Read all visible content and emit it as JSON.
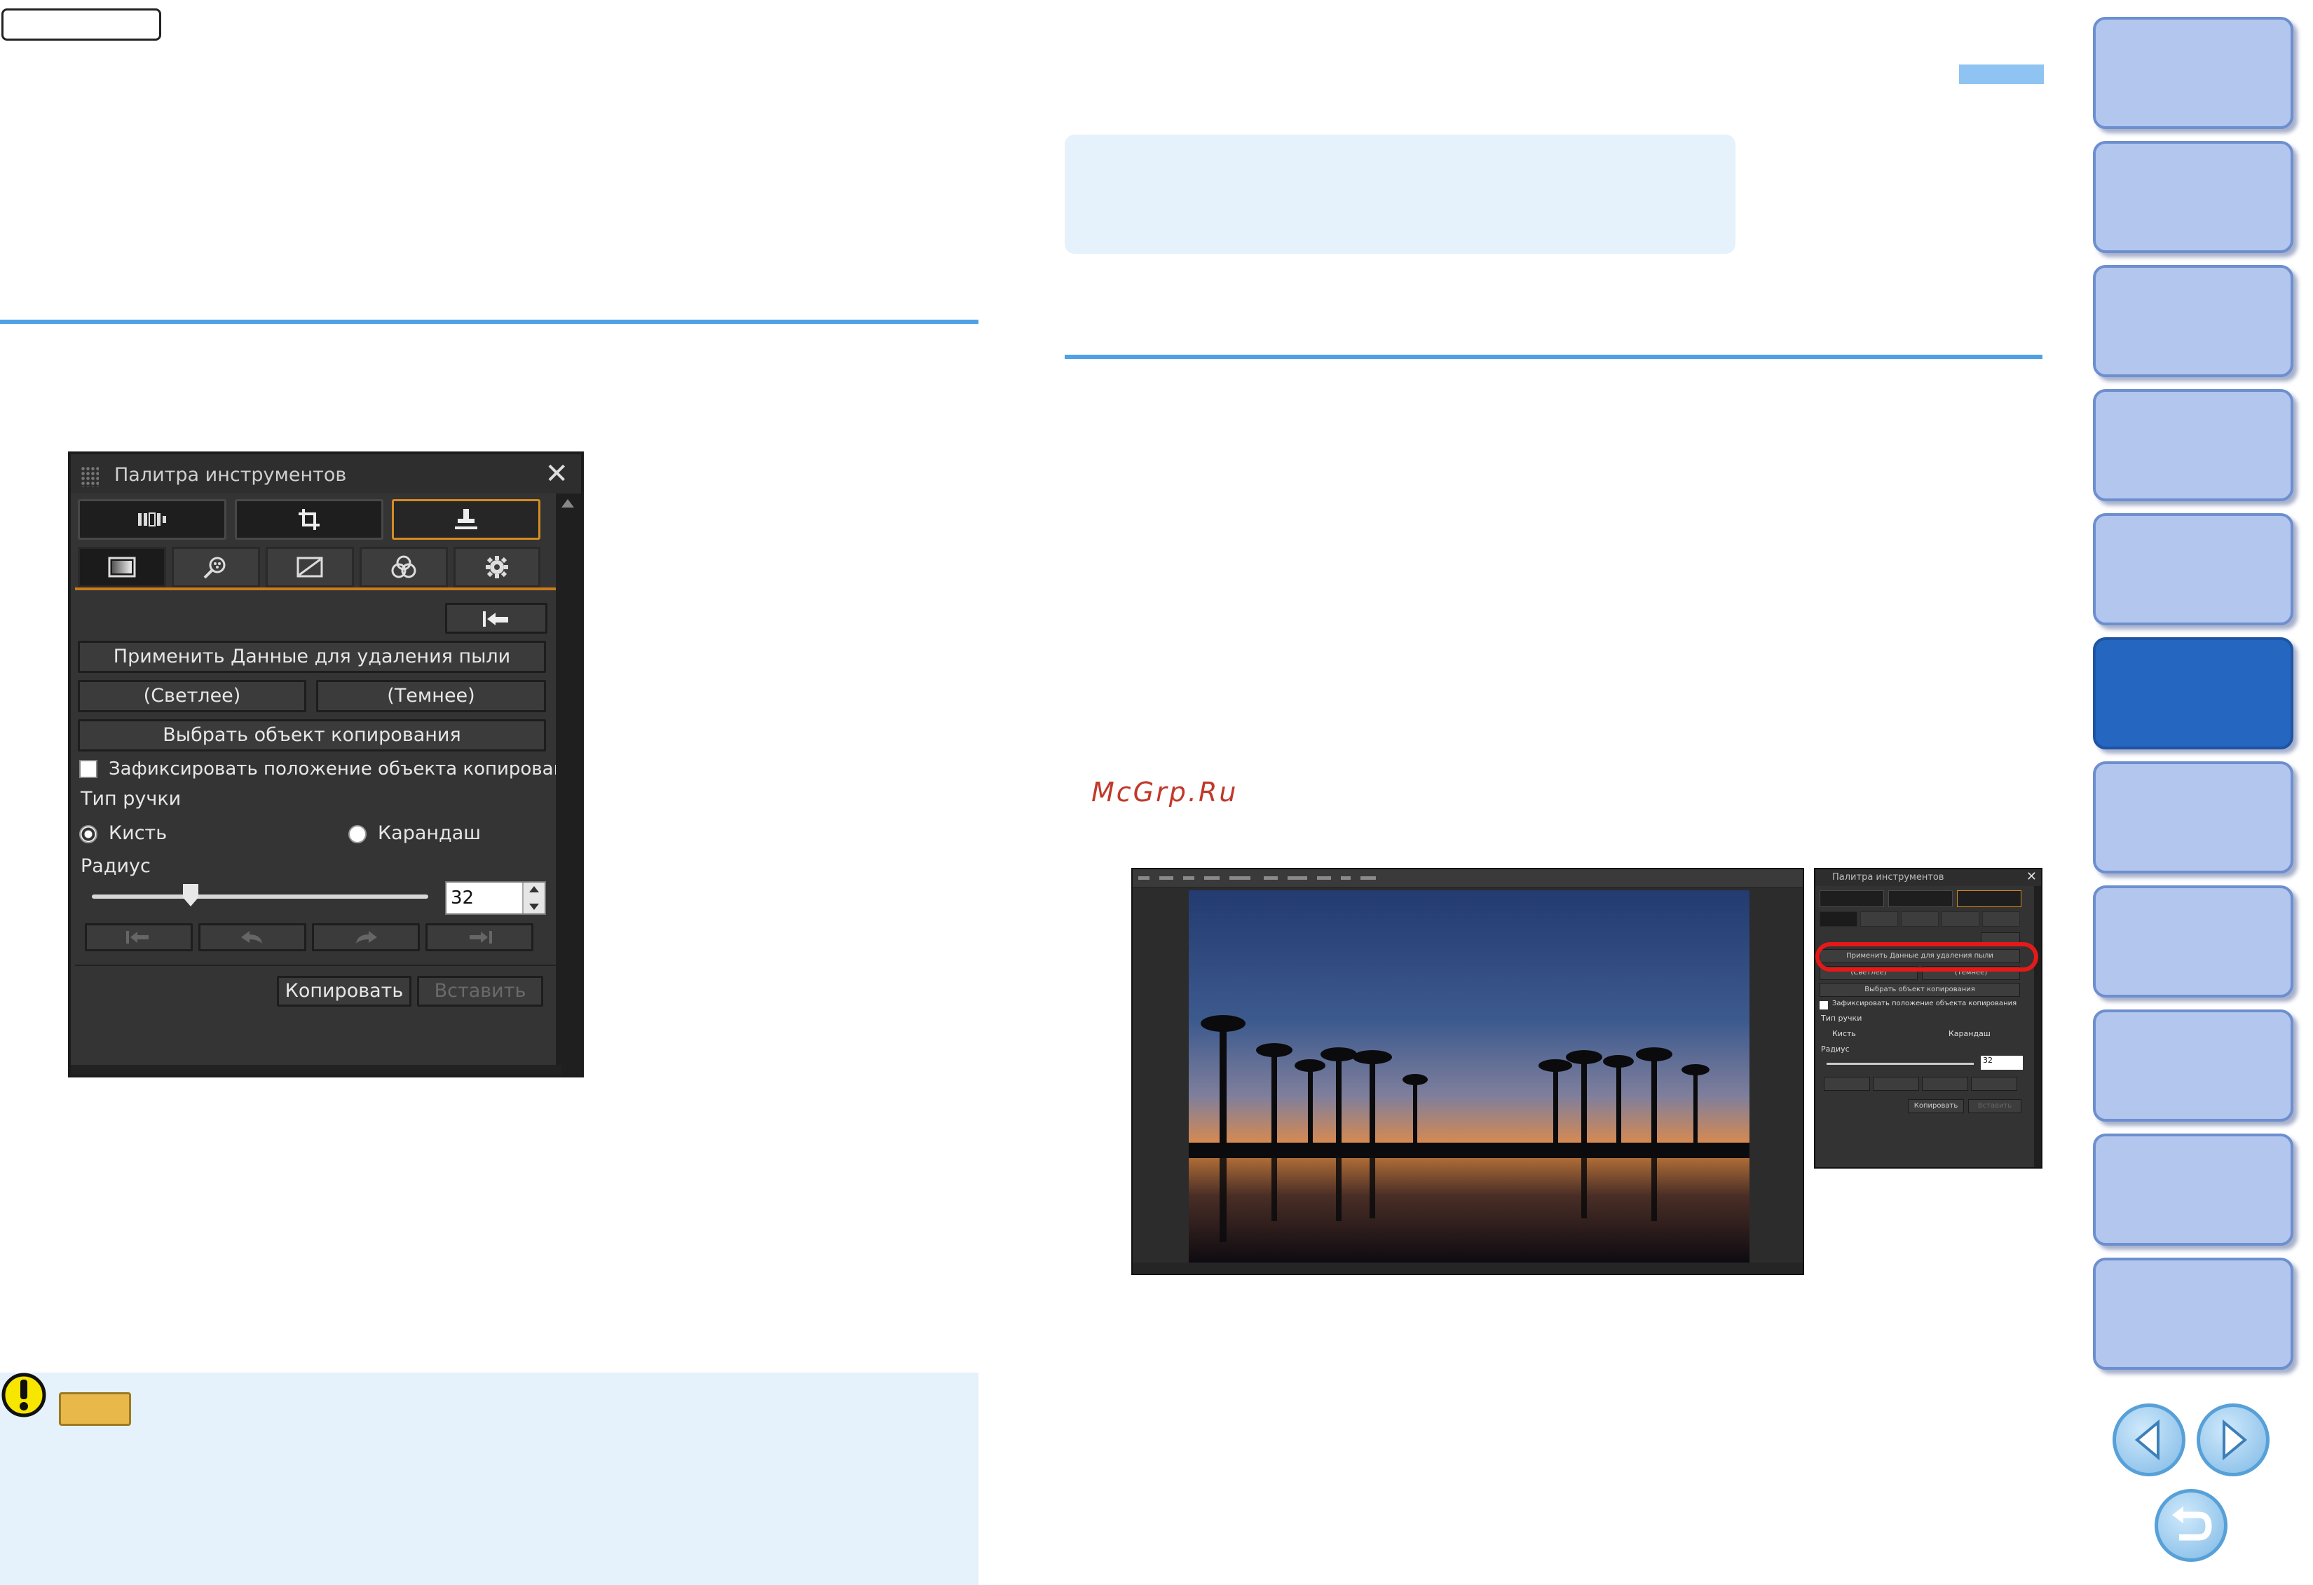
{
  "watermark": "McGrp.Ru",
  "tool_palette": {
    "title": "Палитра инструментов",
    "close_glyph": "✕",
    "apply_dust_button": "Применить Данные для удаления пыли",
    "lighter_button": "(Светлее)",
    "darker_button": "(Темнее)",
    "select_source_button": "Выбрать объект копирования",
    "fix_source_checkbox_label": "Зафиксировать положение объекта копирования",
    "fix_source_checked": false,
    "pen_type_label": "Тип ручки",
    "pen_options": [
      "Кисть",
      "Карандаш"
    ],
    "pen_selected": "Кисть",
    "radius_label": "Радиус",
    "radius_value": "32",
    "copy_button": "Копировать",
    "paste_button": "Вставить",
    "main_tabs": [
      "tone-curve-icon",
      "crop-icon",
      "stamp-icon"
    ],
    "main_tab_active": "stamp-icon",
    "sub_tabs": [
      "brightness-icon",
      "noise-icon",
      "curve-icon",
      "color-icon",
      "gear-icon"
    ],
    "sub_tab_active": "brightness-icon"
  },
  "screenshot_thumbnail": {
    "menu_items": 10,
    "mini_palette": {
      "title": "Палитра инструментов",
      "apply_dust_button": "Применить Данные для удаления пыли",
      "lighter_button": "(Светлее)",
      "darker_button": "(Темнее)",
      "select_source_button": "Выбрать объект копирования",
      "fix_source_checkbox_label": "Зафиксировать положение объекта копирования",
      "pen_type_label": "Тип ручки",
      "pen_options": [
        "Кисть",
        "Карандаш"
      ],
      "radius_label": "Радиус",
      "radius_value": "32",
      "copy_button": "Копировать",
      "paste_button": "Вставить"
    }
  },
  "nav": {
    "tab_count": 11,
    "active_tab_index": 5,
    "colors": {
      "tab": "#b3c6ee",
      "active_tab": "#2466c0",
      "rule": "#4fa0e6",
      "note_bg": "#e5f1fb"
    }
  }
}
